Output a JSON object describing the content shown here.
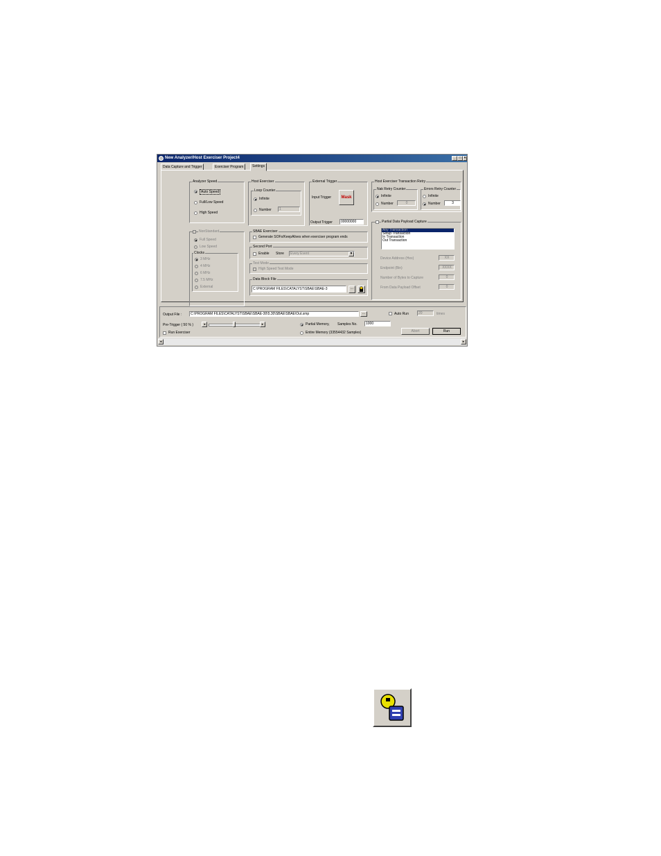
{
  "window": {
    "title": "New Analyzer/Host Exerciser Project4",
    "controls": [
      "_",
      "□",
      "×"
    ]
  },
  "tabs": [
    {
      "label": "Data Capture and Trigger"
    },
    {
      "label": "Exerciser Program"
    },
    {
      "label": "Settings"
    }
  ],
  "analyzer_speed": {
    "title": "Analyzer Speed",
    "options": [
      "Auto Speed",
      "Full/Low Speed",
      "High Speed"
    ],
    "selected": "Auto Speed"
  },
  "nonstandard": {
    "label": "NonStandard",
    "full_speed": "Full Speed",
    "low_speed": "Low Speed",
    "clocks_title": "Clocks",
    "clocks": [
      "3 MHz",
      "4 MHz",
      "6 MHz",
      "7.5 MHz",
      "External"
    ]
  },
  "host_exerciser": {
    "title": "Host Exerciser",
    "loop_counter_title": "Loop Counter",
    "infinite": "Infinite",
    "number": "Number",
    "number_value": "1"
  },
  "external_trigger": {
    "title": "External Trigger",
    "input_trigger": "Input Trigger",
    "mask_button": "Mask",
    "output_trigger": "Output Trigger",
    "output_value": "00000000"
  },
  "transaction_retry": {
    "title": "Host Exerciser Transaction Retry",
    "nak_title": "Nak Retry Counter",
    "nak_infinite": "Infinite",
    "nak_number": "Number",
    "nak_value": "0",
    "errors_title": "Errors Retry Counter",
    "errors_infinite": "Infinite",
    "errors_number": "Number",
    "errors_value": "3"
  },
  "sbae_exerciser": {
    "title": "SBAE Exerciser",
    "generate": "Generate SOFs/KeepAlives when exerciser program ends"
  },
  "second_port": {
    "title": "Second Port",
    "enable": "Enable",
    "store": "Store",
    "store_value": "Every Event"
  },
  "test_mode": {
    "title": "Test Mode",
    "option": "High Speed Test Mode"
  },
  "data_block": {
    "title": "Data Block File",
    "path": "C:\\PROGRAM FILES\\CATALYST\\SBAE\\SBAE-3",
    "browse": "..."
  },
  "partial_payload": {
    "label": "Partial Data Payload Capture",
    "list": [
      "Any Transaction",
      "Setup Transaction",
      "In Transaction",
      "Out Transaction"
    ],
    "device_address": "Device Address (Hex)",
    "device_value": "XX",
    "endpoint": "Endpoint (Bin)",
    "endpoint_value": "XXXX",
    "num_bytes": "Number of Bytes to Capture",
    "num_bytes_value": "0",
    "offset": "From Data Payload Offset",
    "offset_value": "0"
  },
  "bottom": {
    "output_file_label": "Output File :",
    "output_file": "C:\\PROGRAM FILES\\CATALYST\\SBAE\\SBAE-30\\5.30\\SBAE\\SBAE\\Out.smp",
    "browse": "...",
    "auto_run": "Auto Run",
    "auto_run_value": "20",
    "times": "times",
    "pre_trigger": "Pre-Trigger ( 50 % )",
    "pre_trigger_percent": 50,
    "partial_memory": "Partial Memory,",
    "samples_no": "Samples No.",
    "samples_value": "1000",
    "entire_memory": "Entire Memory (33554432 Samples)",
    "run_exerciser": "Run Exerciser",
    "abort": "Abort",
    "run": "Run",
    "left_arrow": "◄",
    "right_arrow": "►"
  },
  "icons": {
    "app_icon": "app-icon",
    "toolbar_button": "data-block-file-icon"
  }
}
